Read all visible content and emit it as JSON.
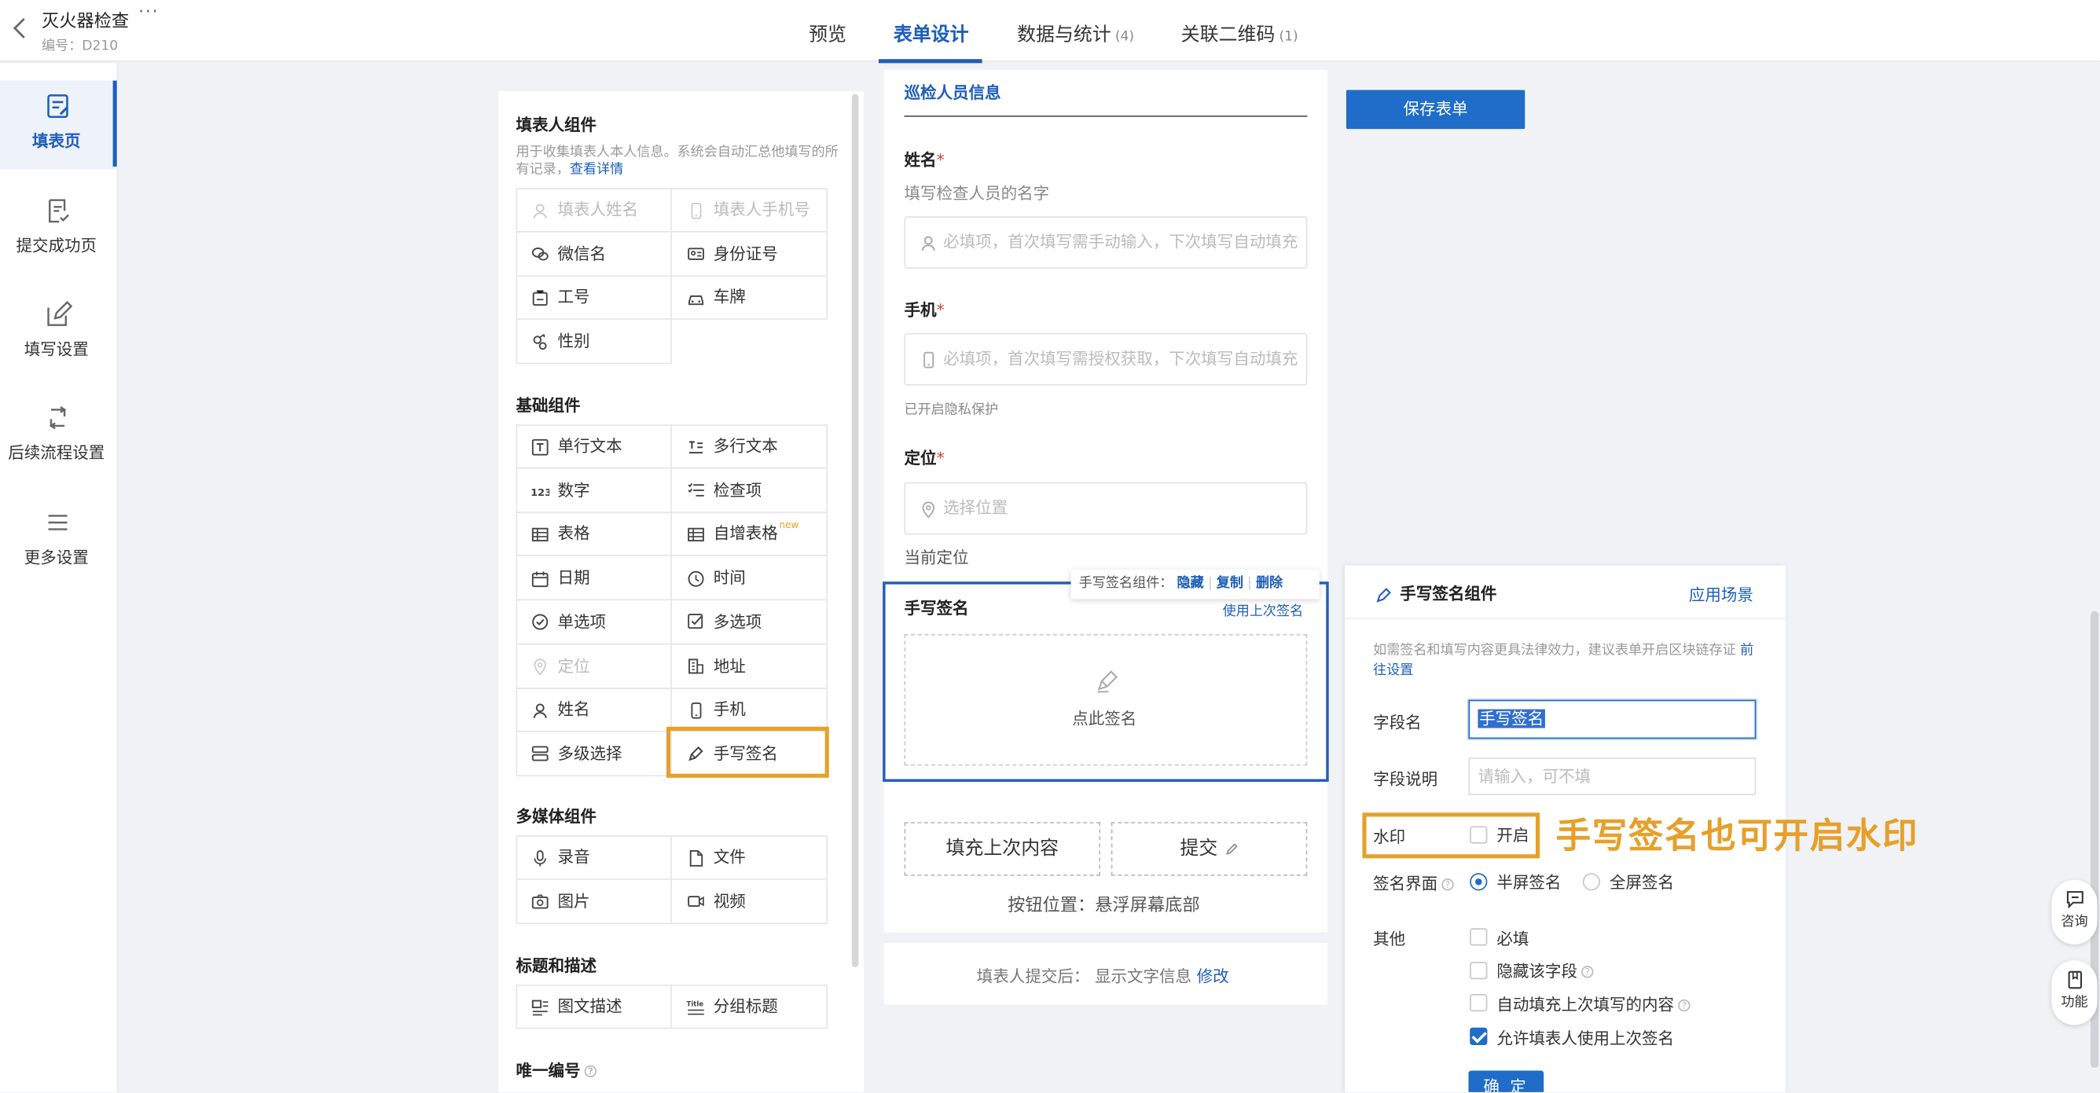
{
  "app": {
    "title": "灭火器检查",
    "more": "···",
    "code": "编号：D210"
  },
  "tabs": [
    {
      "label": "预览",
      "count": ""
    },
    {
      "label": "表单设计",
      "count": ""
    },
    {
      "label": "数据与统计",
      "count": "(4)"
    },
    {
      "label": "关联二维码",
      "count": "(1)"
    }
  ],
  "leftnav": [
    {
      "label": "填表页",
      "icon": "form-edit-icon"
    },
    {
      "label": "提交成功页",
      "icon": "check-doc-icon"
    },
    {
      "label": "填写设置",
      "icon": "edit-icon"
    },
    {
      "label": "后续流程设置",
      "icon": "flow-icon"
    },
    {
      "label": "更多设置",
      "icon": "menu-icon"
    }
  ],
  "components": {
    "filler_title": "填表人组件",
    "filler_hint": "用于收集填表人本人信息。系统会自动汇总他填写的所有记录，",
    "filler_hint_link": "查看详情",
    "filler_items": [
      {
        "label": "填表人姓名",
        "icon": "user-icon",
        "disabled": true
      },
      {
        "label": "填表人手机号",
        "icon": "phone-icon",
        "disabled": true
      },
      {
        "label": "微信名",
        "icon": "wechat-icon"
      },
      {
        "label": "身份证号",
        "icon": "id-card-icon"
      },
      {
        "label": "工号",
        "icon": "badge-icon"
      },
      {
        "label": "车牌",
        "icon": "car-icon"
      },
      {
        "label": "性别",
        "icon": "gender-icon"
      }
    ],
    "basic_title": "基础组件",
    "basic_items": [
      {
        "label": "单行文本",
        "icon": "text-icon"
      },
      {
        "label": "多行文本",
        "icon": "multiline-icon"
      },
      {
        "label": "数字",
        "icon": "number-icon"
      },
      {
        "label": "检查项",
        "icon": "checklist-icon"
      },
      {
        "label": "表格",
        "icon": "table-icon"
      },
      {
        "label": "自增表格",
        "icon": "table-icon",
        "badge": "new"
      },
      {
        "label": "日期",
        "icon": "calendar-icon"
      },
      {
        "label": "时间",
        "icon": "clock-icon"
      },
      {
        "label": "单选项",
        "icon": "radio-icon"
      },
      {
        "label": "多选项",
        "icon": "checkbox-icon"
      },
      {
        "label": "定位",
        "icon": "location-icon",
        "disabled": true
      },
      {
        "label": "地址",
        "icon": "building-icon"
      },
      {
        "label": "姓名",
        "icon": "user-icon"
      },
      {
        "label": "手机",
        "icon": "phone-icon"
      },
      {
        "label": "多级选择",
        "icon": "cascade-icon"
      },
      {
        "label": "手写签名",
        "icon": "pen-icon"
      }
    ],
    "media_title": "多媒体组件",
    "media_items": [
      {
        "label": "录音",
        "icon": "mic-icon"
      },
      {
        "label": "文件",
        "icon": "file-icon"
      },
      {
        "label": "图片",
        "icon": "camera-icon"
      },
      {
        "label": "视频",
        "icon": "video-icon"
      }
    ],
    "title_title": "标题和描述",
    "title_items": [
      {
        "label": "图文描述",
        "icon": "image-text-icon"
      },
      {
        "label": "分组标题",
        "icon": "title-icon"
      }
    ],
    "unique_title": "唯一编号"
  },
  "form": {
    "section": "巡检人员信息",
    "name_label": "姓名",
    "name_desc": "填写检查人员的名字",
    "name_placeholder": "必填项，首次填写需手动输入，下次填写自动填充",
    "phone_label": "手机",
    "phone_placeholder": "必填项，首次填写需授权获取，下次填写自动填充",
    "privacy": "已开启隐私保护",
    "loc_label": "定位",
    "loc_placeholder": "选择位置",
    "current_loc": "当前定位",
    "required_mark": "*",
    "sig_toolbar": {
      "label": "手写签名组件：",
      "hide": "隐藏",
      "copy": "复制",
      "delete": "删除",
      "sep": "|"
    },
    "sig_title": "手写签名",
    "sig_use_last": "使用上次签名",
    "sig_pad": "点此签名",
    "btn_fill_last": "填充上次内容",
    "btn_submit": "提交",
    "btn_position": "按钮位置：悬浮屏幕底部",
    "after_label": "填表人提交后：",
    "after_value": "显示文字信息",
    "after_link": "修改"
  },
  "save_button": "保存表单",
  "props": {
    "title": "手写签名组件",
    "scene_link": "应用场景",
    "note": "如需签名和填写内容更具法律效力，建议表单开启区块链存证",
    "note_link": "前往设置",
    "field_name_label": "字段名",
    "field_name_value": "手写签名",
    "field_desc_label": "字段说明",
    "field_desc_placeholder": "请输入，可不填",
    "watermark_label": "水印",
    "watermark_option": "开启",
    "sign_ui_label": "签名界面",
    "sign_half": "半屏签名",
    "sign_full": "全屏签名",
    "other_label": "其他",
    "opt_required": "必填",
    "opt_hide": "隐藏该字段",
    "opt_autofill": "自动填充上次填写的内容",
    "opt_allow_last": "允许填表人使用上次签名",
    "ok_button": "确 定"
  },
  "annotation": "手写签名也可开启水印",
  "float": {
    "consult": "咨询",
    "feature": "功能"
  },
  "colors": {
    "primary": "#1f6cc9",
    "highlight": "#e6a02a",
    "required": "#e03a3a"
  }
}
